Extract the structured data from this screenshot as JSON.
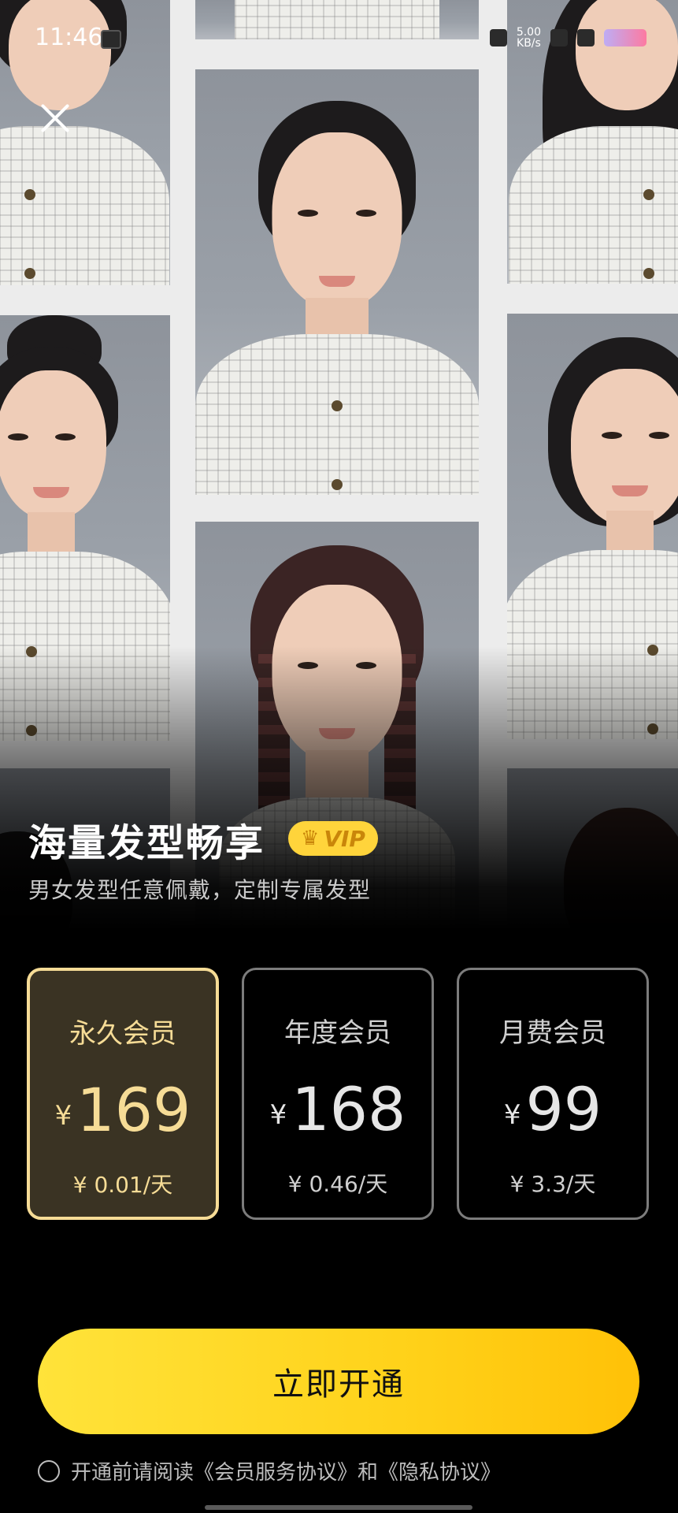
{
  "status_bar": {
    "time": "11:46",
    "net_speed_value": "5.00",
    "net_speed_unit": "KB/s"
  },
  "header": {
    "close_icon": "close-icon"
  },
  "promo": {
    "title": "海量发型畅享",
    "vip_badge": "VIP",
    "subtitle": "男女发型任意佩戴，定制专属发型"
  },
  "plans": [
    {
      "name": "永久会员",
      "currency": "¥",
      "price": "169",
      "daily": "¥ 0.01/天",
      "selected": true
    },
    {
      "name": "年度会员",
      "currency": "¥",
      "price": "168",
      "daily": "¥ 0.46/天",
      "selected": false
    },
    {
      "name": "月费会员",
      "currency": "¥",
      "price": "99",
      "daily": "¥ 3.3/天",
      "selected": false
    }
  ],
  "cta": {
    "label": "立即开通"
  },
  "agreement": {
    "text": "开通前请阅读《会员服务协议》和《隐私协议》",
    "checked": false
  },
  "colors": {
    "accent": "#ffd21a",
    "selected_border": "#f6dc96",
    "background": "#000000"
  }
}
